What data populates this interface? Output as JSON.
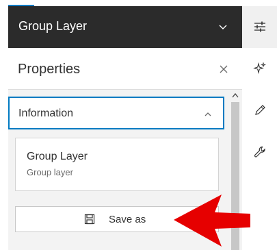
{
  "group_header": {
    "title": "Group Layer"
  },
  "properties": {
    "title": "Properties"
  },
  "information": {
    "label": "Information",
    "layer_name": "Group Layer",
    "layer_type": "Group layer"
  },
  "save_button": {
    "label": "Save as"
  },
  "action_bar": {
    "items": [
      {
        "icon": "sliders-icon",
        "active": true
      },
      {
        "icon": "sparkle-icon",
        "active": false
      },
      {
        "icon": "pencil-icon",
        "active": false
      },
      {
        "icon": "wrench-icon",
        "active": false
      }
    ]
  },
  "colors": {
    "header_bg": "#2b2b2b",
    "accent": "#007ac2",
    "annotation_arrow": "#e60000"
  }
}
